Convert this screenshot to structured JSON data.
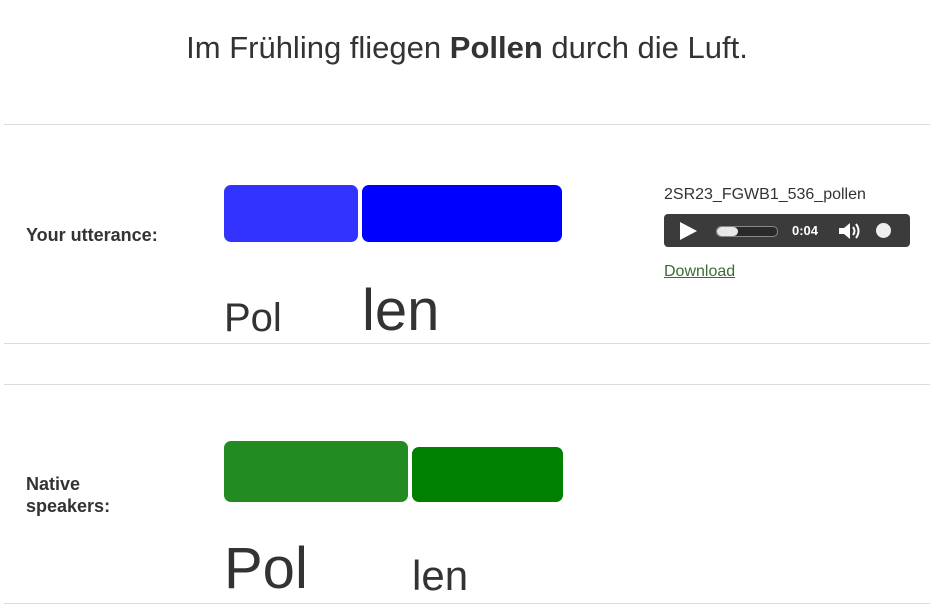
{
  "sentence": {
    "before": "Im Frühling fliegen ",
    "keyword": "Pollen",
    "after": " durch die Luft."
  },
  "your_utterance": {
    "label": "Your utterance:",
    "syllables": [
      "Pol",
      "len"
    ],
    "bar_colors": [
      "#3333ff",
      "#0000ff"
    ],
    "audio": {
      "filename": "2SR23_FGWB1_536_pollen",
      "time": "0:04",
      "progress": 0.35,
      "download_label": "Download"
    }
  },
  "native_speakers": {
    "label_line1": "Native",
    "label_line2": "speakers:",
    "syllables": [
      "Pol",
      "len"
    ],
    "bar_colors": [
      "#228b22",
      "#008000"
    ]
  },
  "colors": {
    "text": "#333333",
    "divider": "#dddddd",
    "player_bg": "#3b3b3b",
    "link": "#3d6b35"
  },
  "icons": [
    "play-icon",
    "volume-icon"
  ]
}
